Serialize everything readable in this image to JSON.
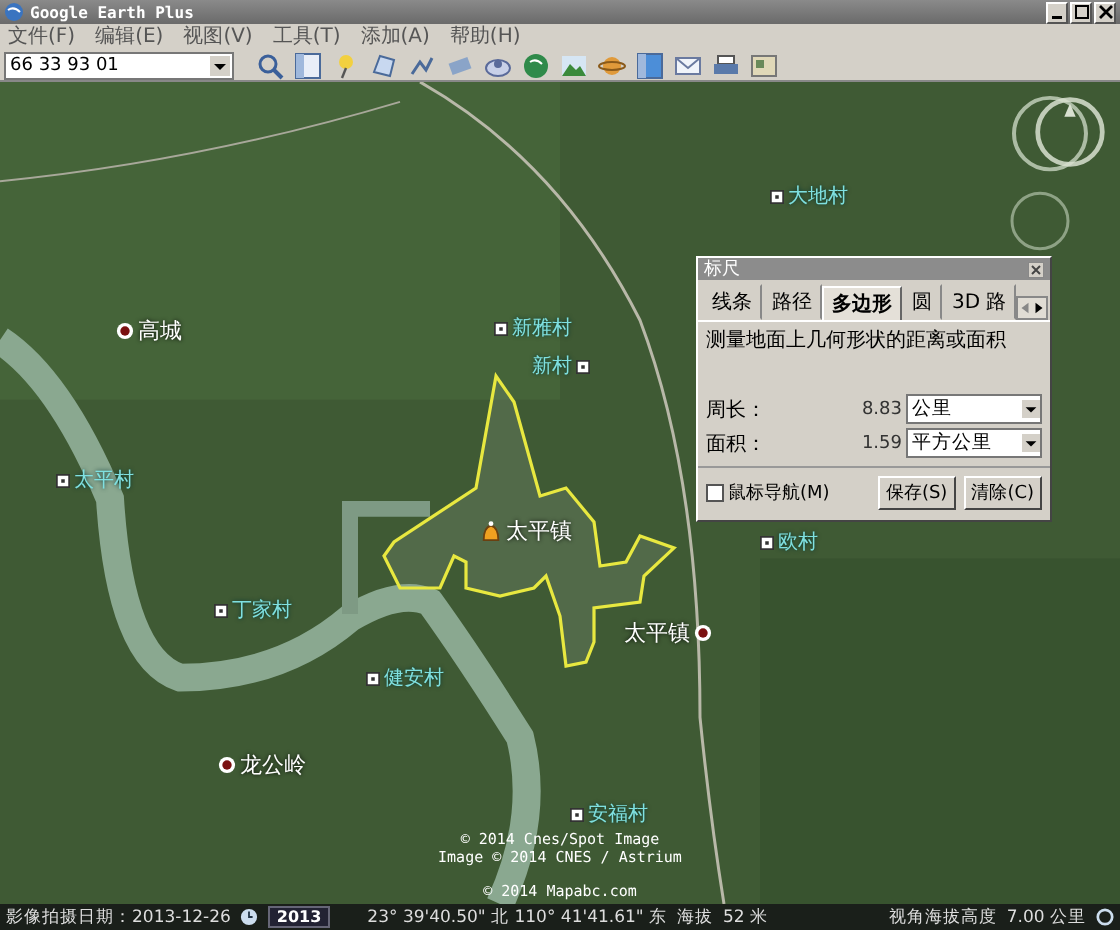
{
  "window": {
    "title": "Google Earth Plus"
  },
  "menu": [
    "文件(F)",
    "编辑(E)",
    "视图(V)",
    "工具(T)",
    "添加(A)",
    "帮助(H)"
  ],
  "search": {
    "value": "66 33 93 01"
  },
  "map": {
    "placemarks": [
      {
        "name": "高城",
        "kind": "town"
      },
      {
        "name": "太平村",
        "kind": "village"
      },
      {
        "name": "丁家村",
        "kind": "village"
      },
      {
        "name": "健安村",
        "kind": "village"
      },
      {
        "name": "龙公岭",
        "kind": "town"
      },
      {
        "name": "新雅村",
        "kind": "village"
      },
      {
        "name": "新村",
        "kind": "village"
      },
      {
        "name": "太平镇",
        "kind": "marker"
      },
      {
        "name": "太平镇",
        "kind": "town"
      },
      {
        "name": "欧村",
        "kind": "village"
      },
      {
        "name": "安福村",
        "kind": "village"
      },
      {
        "name": "大地村",
        "kind": "village"
      }
    ],
    "copyright": [
      "© 2014 Cnes/Spot Image",
      "Image © 2014 CNES / Astrium",
      "© 2014 Mapabc.com"
    ]
  },
  "ruler": {
    "title": "标尺",
    "tabs": [
      {
        "label": "线条",
        "selected": false
      },
      {
        "label": "路径",
        "selected": false
      },
      {
        "label": "多边形",
        "selected": true
      },
      {
        "label": "圆",
        "selected": false
      },
      {
        "label": "3D 路",
        "selected": false
      }
    ],
    "description": "测量地面上几何形状的距离或面积",
    "measures": [
      {
        "label": "周长：",
        "value": "8.83",
        "unit": "公里"
      },
      {
        "label": "面积：",
        "value": "1.59",
        "unit": "平方公里"
      }
    ],
    "mouse_nav": {
      "label": "鼠标导航(M)",
      "checked": false
    },
    "buttons": [
      "保存(S)",
      "清除(C)"
    ]
  },
  "status_bar": {
    "imagery_date": "影像拍摄日期：2013-12-26",
    "year": "2013",
    "coordinates": "23° 39'40.50\" 北 110° 41'41.61\" 东",
    "elevation_label": "海拔",
    "elevation": "52 米",
    "eye_alt_label": "视角海拔高度",
    "eye_alt": "7.00 公里"
  }
}
